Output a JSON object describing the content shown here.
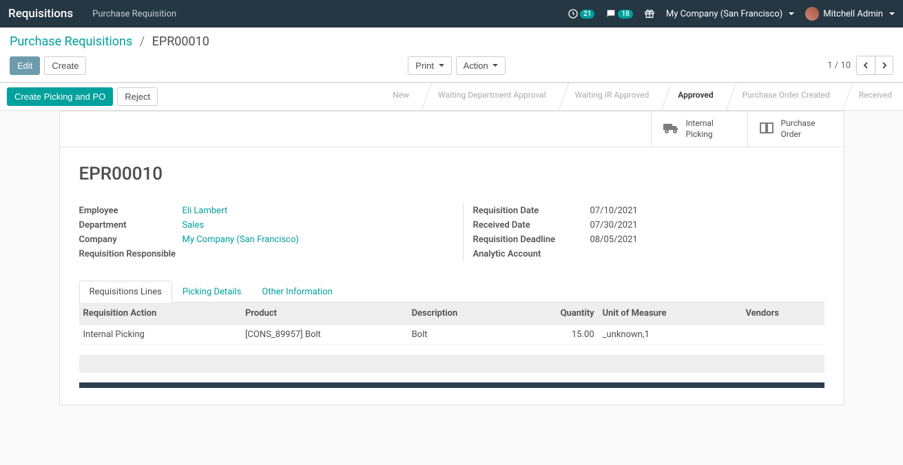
{
  "nav": {
    "brand": "Requisitions",
    "menu": "Purchase Requisition",
    "activity_count": "21",
    "msg_count": "18",
    "company": "My Company (San Francisco)",
    "user": "Mitchell Admin"
  },
  "breadcrumb": {
    "root": "Purchase Requisitions",
    "current": "EPR00010"
  },
  "buttons": {
    "edit": "Edit",
    "create": "Create",
    "print": "Print",
    "action": "Action",
    "create_picking_po": "Create Picking and PO",
    "reject": "Reject"
  },
  "pager": {
    "text": "1 / 10"
  },
  "stages": [
    "New",
    "Waiting Department Approval",
    "Waiting IR Approved",
    "Approved",
    "Purchase Order Created",
    "Received"
  ],
  "stage_active_index": 3,
  "stats": {
    "picking_l1": "Internal",
    "picking_l2": "Picking",
    "po_l1": "Purchase",
    "po_l2": "Order"
  },
  "record": {
    "title": "EPR00010",
    "left": {
      "employee_lbl": "Employee",
      "employee": "Eli Lambert",
      "department_lbl": "Department",
      "department": "Sales",
      "company_lbl": "Company",
      "company": "My Company (San Francisco)",
      "responsible_lbl": "Requisition Responsible",
      "responsible": ""
    },
    "right": {
      "reqdate_lbl": "Requisition Date",
      "reqdate": "07/10/2021",
      "recvdate_lbl": "Received Date",
      "recvdate": "07/30/2021",
      "deadline_lbl": "Requisition Deadline",
      "deadline": "08/05/2021",
      "analytic_lbl": "Analytic Account",
      "analytic": ""
    }
  },
  "tabs": [
    "Requisitions Lines",
    "Picking Details",
    "Other Information"
  ],
  "tab_active_index": 0,
  "table": {
    "cols": [
      "Requisition Action",
      "Product",
      "Description",
      "Quantity",
      "Unit of Measure",
      "Vendors"
    ],
    "rows": [
      {
        "action": "Internal Picking",
        "product": "[CONS_89957] Bolt",
        "desc": "Bolt",
        "qty": "15.00",
        "uom": "_unknown,1",
        "vendors": ""
      }
    ]
  }
}
